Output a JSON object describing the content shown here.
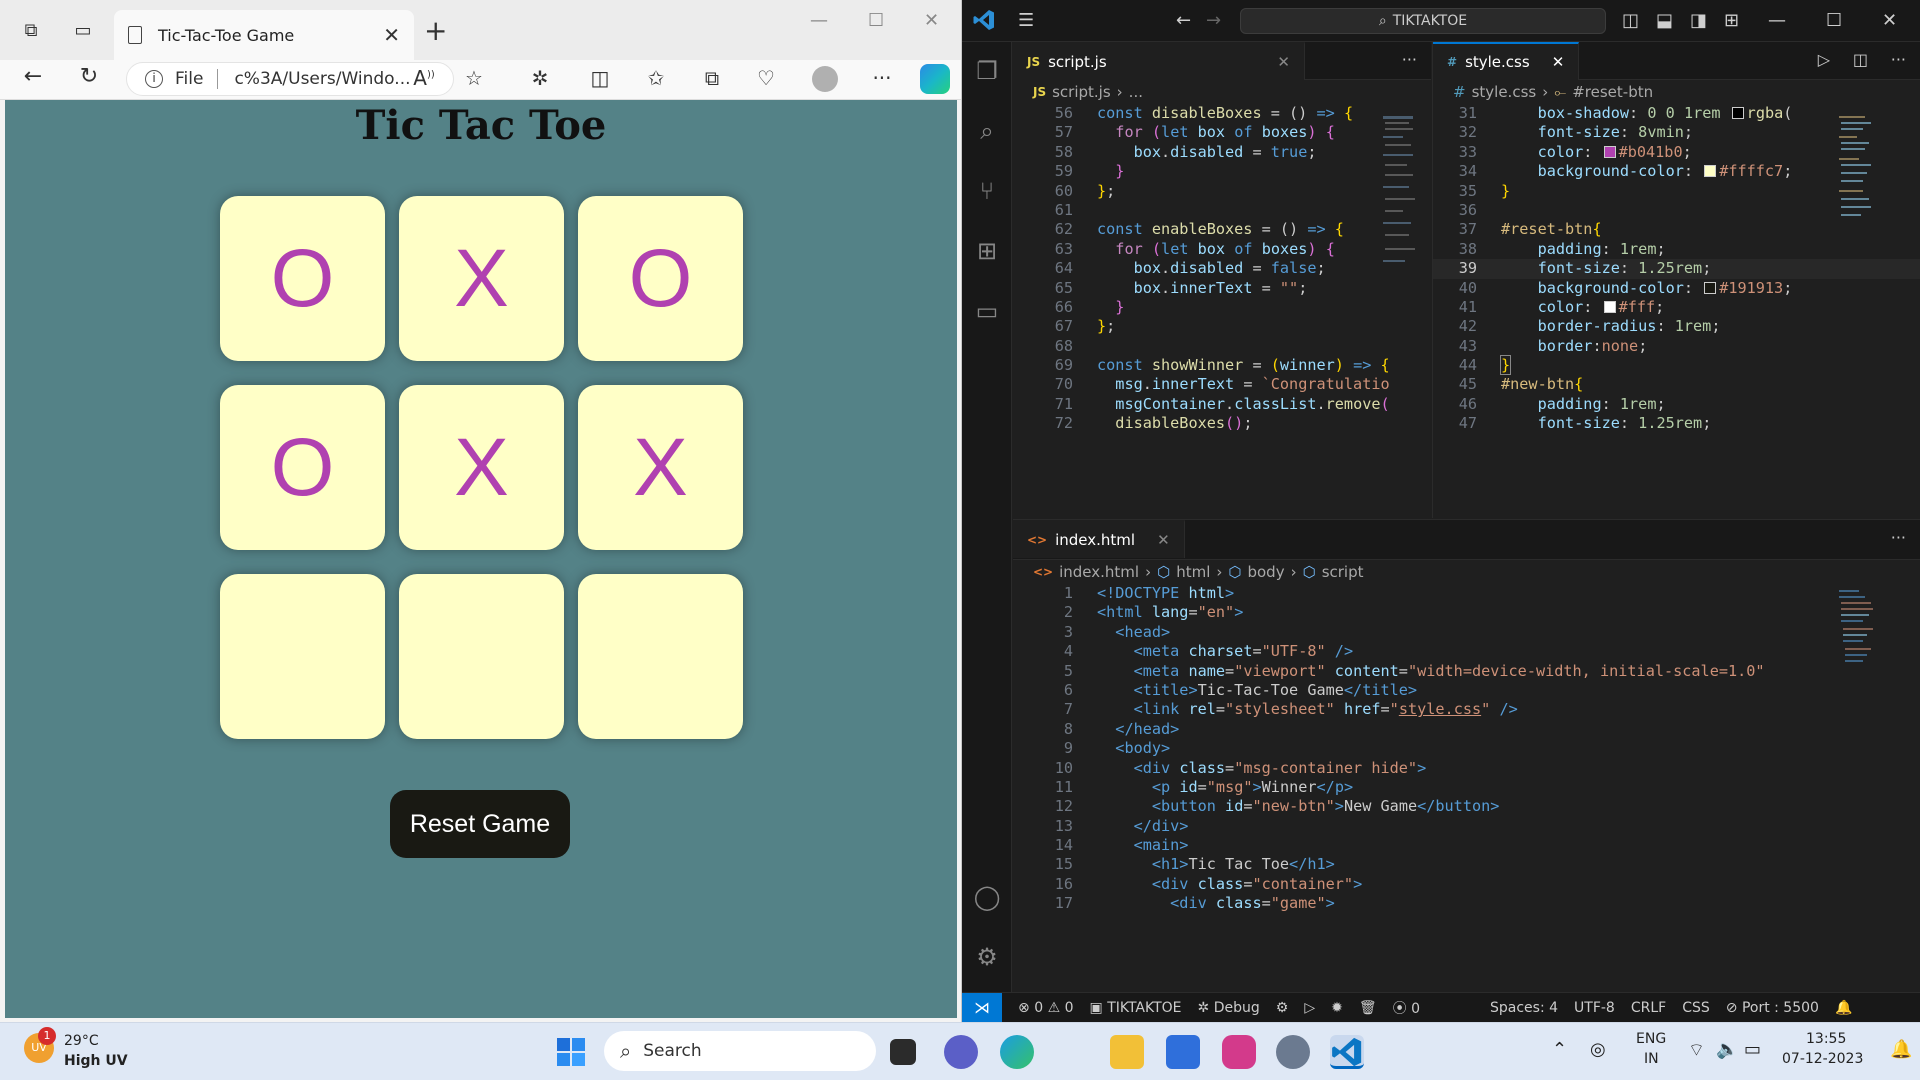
{
  "browser": {
    "tab_title": "Tic-Tac-Toe Game",
    "url_scheme": "File",
    "url": "c%3A/Users/Windo...",
    "page": {
      "heading": "Tic Tac Toe",
      "cells": [
        "O",
        "X",
        "O",
        "O",
        "X",
        "X",
        "",
        "",
        ""
      ],
      "reset_label": "Reset Game",
      "bg_color": "#548287",
      "cell_color": "#ffffc7",
      "mark_color": "#b041b0"
    }
  },
  "vscode": {
    "search_label": "TIKTAKTOE",
    "tabs": {
      "script": "script.js",
      "style": "style.css",
      "index": "index.html"
    },
    "crumbs": {
      "script_file": "script.js",
      "script_tail": "...",
      "style_file": "style.css",
      "style_tail": "#reset-btn",
      "html_file": "index.html",
      "html_1": "html",
      "html_2": "body",
      "html_3": "script"
    },
    "status": {
      "errors": "0",
      "warnings": "0",
      "folder": "TIKTAKTOE",
      "debug": "Debug",
      "ports": "0",
      "spaces": "Spaces: 4",
      "encoding": "UTF-8",
      "eol": "CRLF",
      "language": "CSS",
      "port": "Port : 5500"
    }
  },
  "taskbar": {
    "temperature": "29°C",
    "uv": "High UV",
    "weather_badge": "1",
    "search": "Search",
    "lang1": "ENG",
    "lang2": "IN",
    "time": "13:55",
    "date": "07-12-2023"
  }
}
